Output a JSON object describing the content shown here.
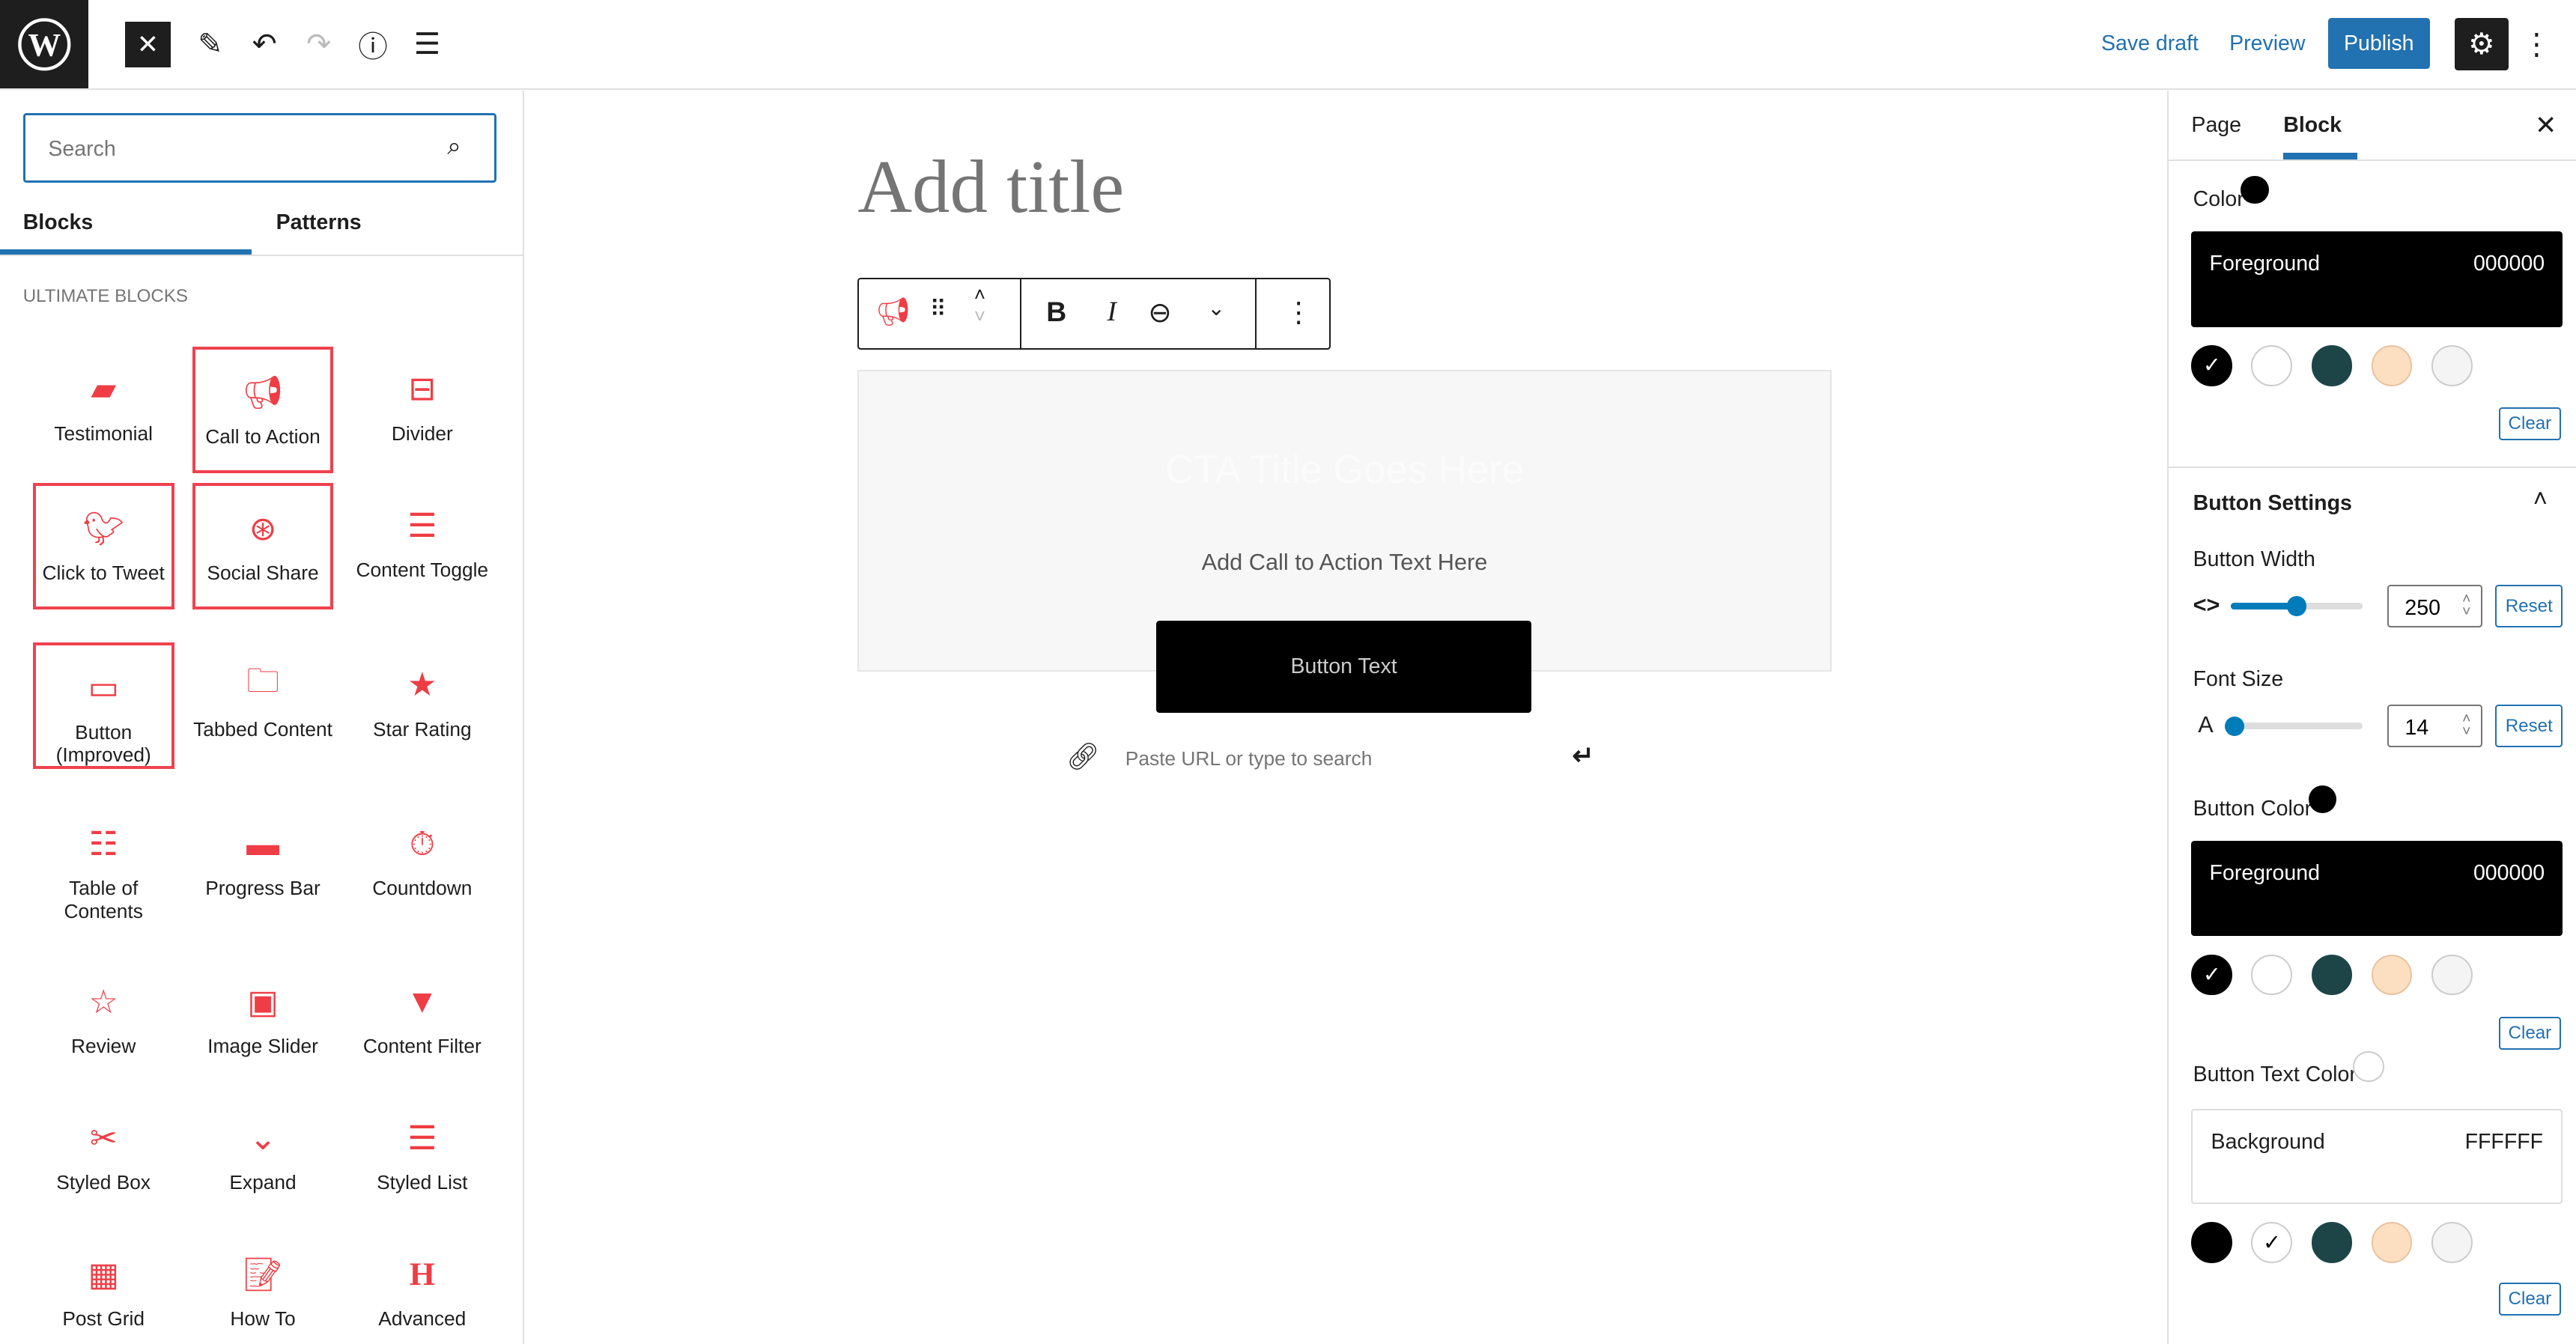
{
  "topbar": {
    "logo": "wordpress-logo",
    "save_draft": "Save draft",
    "preview": "Preview",
    "publish": "Publish",
    "icons": [
      "close-icon",
      "pencil-icon",
      "undo-icon",
      "redo-icon",
      "info-icon",
      "list-view-icon",
      "gear-icon",
      "more-vertical-icon"
    ]
  },
  "inserter": {
    "search_placeholder": "Search",
    "tabs": [
      "Blocks",
      "Patterns"
    ],
    "active_tab": "Blocks",
    "category": "Ultimate Blocks",
    "blocks": [
      {
        "label": "Testimonial",
        "icon": "speech-bubble-icon",
        "highlighted": false
      },
      {
        "label": "Call to Action",
        "icon": "megaphone-icon",
        "highlighted": true
      },
      {
        "label": "Divider",
        "icon": "divider-icon",
        "highlighted": false
      },
      {
        "label": "Click to Tweet",
        "icon": "twitter-bird-icon",
        "highlighted": true
      },
      {
        "label": "Social Share",
        "icon": "share-icon",
        "highlighted": true
      },
      {
        "label": "Content Toggle",
        "icon": "toggle-icon",
        "highlighted": false
      },
      {
        "label": "Button (Improved)",
        "icon": "button-icon",
        "highlighted": true
      },
      {
        "label": "Tabbed Content",
        "icon": "tabs-icon",
        "highlighted": false
      },
      {
        "label": "Star Rating",
        "icon": "star-icon",
        "highlighted": false
      },
      {
        "label": "Table of Contents",
        "icon": "toc-icon",
        "highlighted": false
      },
      {
        "label": "Progress Bar",
        "icon": "progress-bar-icon",
        "highlighted": false
      },
      {
        "label": "Countdown",
        "icon": "timer-icon",
        "highlighted": false
      },
      {
        "label": "Review",
        "icon": "review-icon",
        "highlighted": false
      },
      {
        "label": "Image Slider",
        "icon": "slider-icon",
        "highlighted": false
      },
      {
        "label": "Content Filter",
        "icon": "filter-icon",
        "highlighted": false
      },
      {
        "label": "Styled Box",
        "icon": "styled-box-icon",
        "highlighted": false
      },
      {
        "label": "Expand",
        "icon": "chevron-down-icon",
        "highlighted": false
      },
      {
        "label": "Styled List",
        "icon": "list-icon",
        "highlighted": false
      },
      {
        "label": "Post Grid",
        "icon": "grid-icon",
        "highlighted": false
      },
      {
        "label": "How To",
        "icon": "howto-icon",
        "highlighted": false
      },
      {
        "label": "Advanced",
        "icon": "heading-icon",
        "highlighted": false
      }
    ]
  },
  "editor": {
    "title_placeholder": "Add title",
    "cta_title": "CTA Title Goes Here",
    "cta_text": "Add Call to Action Text Here",
    "button_text": "Button Text",
    "url_placeholder": "Paste URL or type to search"
  },
  "sidebar": {
    "tabs": [
      "Page",
      "Block"
    ],
    "active_tab": "Block",
    "color": {
      "label": "Color",
      "indicator": "#000000",
      "name": "Foreground",
      "value": "000000",
      "clear": "Clear"
    },
    "palette": [
      "#000000",
      "#ffffff",
      "#1d4548",
      "#fcdfc1",
      "#f4f4f4"
    ],
    "button_settings": {
      "title": "Button Settings",
      "width": {
        "label": "Button Width",
        "value": "250",
        "fill_percent": 50,
        "reset": "Reset"
      },
      "font_size": {
        "label": "Font Size",
        "value": "14",
        "fill_percent": 3,
        "reset": "Reset"
      }
    },
    "button_color": {
      "label": "Button Color",
      "indicator": "#000000",
      "name": "Foreground",
      "value": "000000",
      "clear": "Clear"
    },
    "button_text_color": {
      "label": "Button Text Color",
      "indicator": "#ffffff",
      "name": "Background",
      "value": "FFFFFF",
      "clear": "Clear"
    }
  },
  "colors": {
    "accent": "#2271b1",
    "block_red": "#ef3d45"
  }
}
